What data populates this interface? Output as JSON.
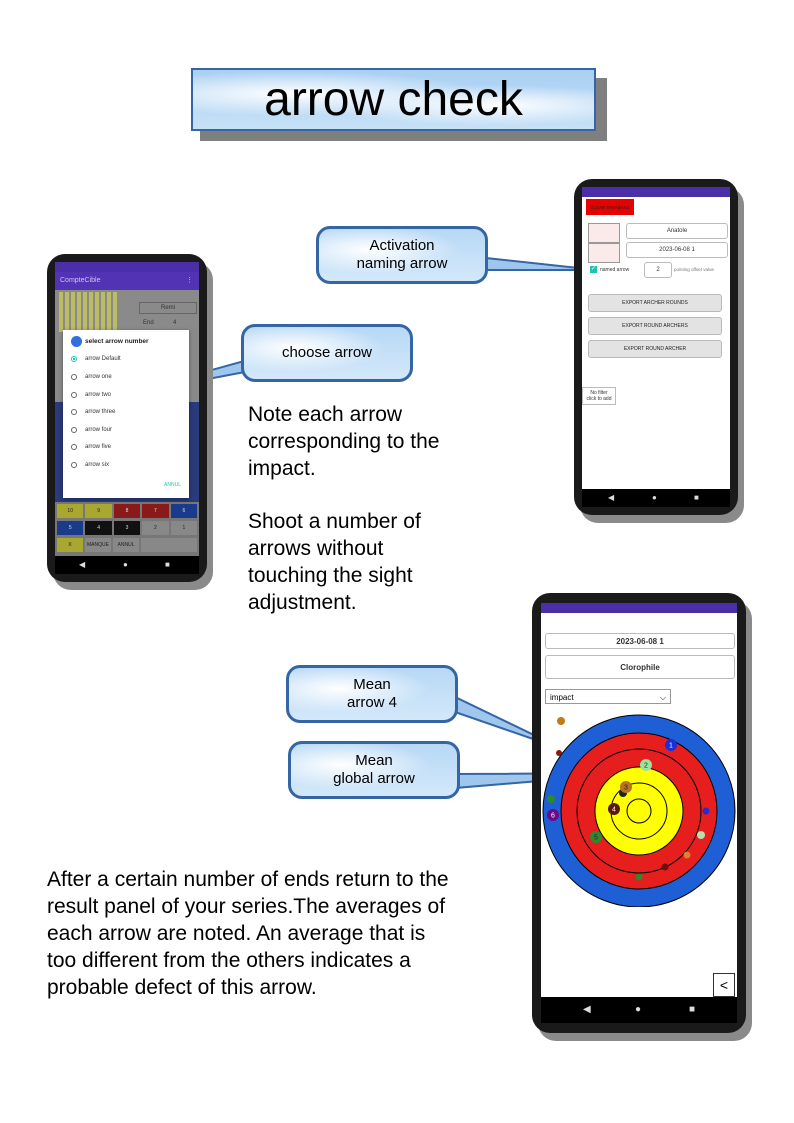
{
  "title": "arrow check",
  "callouts": {
    "choose_arrow": "choose arrow",
    "activation": "Activation\nnaming arrow",
    "mean_arrow4": "Mean\narrow 4",
    "mean_global": "Mean\nglobal arrow"
  },
  "paragraphs": {
    "note": "Note each arrow\ncorresponding to the\nimpact.",
    "shoot": "Shoot a number of\narrows without\ntouching the sight\nadjustment.",
    "after": "After a certain number of ends return to the\nresult panel of your series.The averages of\neach arrow are noted. An average that is\ntoo different from the others indicates a\nprobable defect of this arrow."
  },
  "phone1": {
    "app_title": "CompteCible",
    "dropdown_value": "Remi",
    "end_label": "End",
    "end_value": "4",
    "dialog_title": "select arrow number",
    "options": [
      "arrow Default",
      "arrow one",
      "arrow two",
      "arrow three",
      "arrow four",
      "arrow five",
      "arrow six"
    ],
    "selected_index": 0,
    "cancel": "ANNUL",
    "keypad_row1": [
      "10",
      "9",
      "8",
      "7",
      "6"
    ],
    "keypad_row2": [
      "5",
      "4",
      "3",
      "2",
      "1"
    ],
    "keypad_row3": [
      "X",
      "MANQUE",
      "ANNUL"
    ]
  },
  "phone2": {
    "red_button": "CLEAR DATABASE",
    "archer_name": "Anatole",
    "round_name": "2023-06-08 1",
    "named_arrow_label": "named arrow",
    "named_arrow_checked": true,
    "offset_value": "2",
    "offset_label": "pointing offset value",
    "buttons": [
      "EXPORT ARCHER ROUNDS",
      "EXPORT ROUND ARCHERS",
      "EXPORT ROUND ARCHER"
    ],
    "filter_box": "No filter\nclick to add"
  },
  "phone3": {
    "round_name": "2023-06-08 1",
    "archer_name": "Clorophile",
    "view_select": "impact",
    "markers": [
      {
        "label": "1",
        "color": "#1a2fd6"
      },
      {
        "label": "2",
        "color": "#9de29a"
      },
      {
        "label": "3",
        "color": "#b87320"
      },
      {
        "label": "4",
        "color": "#5a1a0a"
      },
      {
        "label": "5",
        "color": "#2c8a2c"
      },
      {
        "label": "6",
        "color": "#6a0a8a"
      }
    ],
    "colors": {
      "blue_ring": "#1e5fd6",
      "red_ring": "#e61e1e",
      "yellow_ring": "#ffff00",
      "status": "#4b2fa8"
    }
  }
}
